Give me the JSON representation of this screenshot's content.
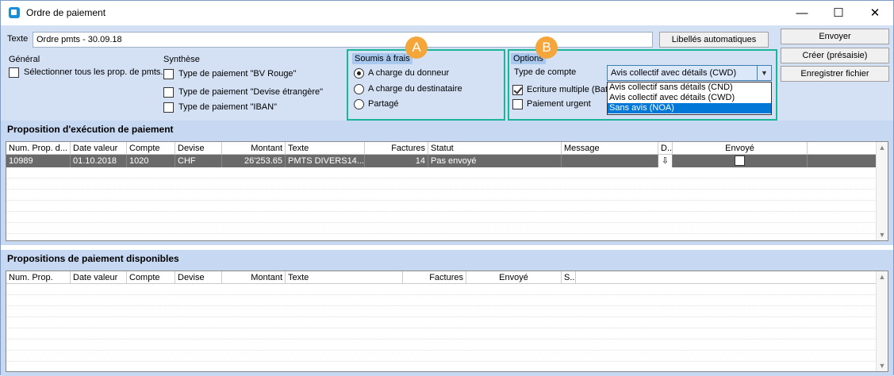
{
  "window": {
    "title": "Ordre de paiement",
    "minimize": "—",
    "maximize": "☐",
    "close": "✕"
  },
  "texte": {
    "label": "Texte",
    "value": "Ordre pmts - 30.09.18",
    "auto_button": "Libellés automatiques"
  },
  "actions": {
    "envoyer": "Envoyer",
    "creer": "Créer (présaisie)",
    "enregistrer": "Enregistrer fichier"
  },
  "general": {
    "header": "Général",
    "select_all": "Sélectionner tous les prop. de pmts."
  },
  "synthese": {
    "header": "Synthèse",
    "items": [
      "Type de paiement \"BV Rouge\"",
      "Type de paiement \"Devise étrangère\"",
      "Type de paiement \"IBAN\""
    ]
  },
  "frais": {
    "header": "Soumis à frais",
    "badge": "A",
    "options": [
      "A charge du donneur",
      "A charge du destinataire",
      "Partagé"
    ],
    "selected": 0
  },
  "options": {
    "header": "Options",
    "badge": "B",
    "type_compte_label": "Type de compte",
    "type_compte_value": "Avis collectif avec détails (CWD)",
    "dropdown_items": [
      "Avis collectif sans détails (CND)",
      "Avis collectif avec détails (CWD)",
      "Sans avis (NOA)"
    ],
    "dropdown_selected": 2,
    "ecriture_multiple": "Ecriture multiple (Batc",
    "ecriture_checked": true,
    "paiement_urgent": "Paiement urgent",
    "urgent_checked": false
  },
  "proposition": {
    "title": "Proposition d'exécution de paiement",
    "columns": [
      "Num. Prop. d...",
      "Date valeur",
      "Compte",
      "Devise",
      "Montant",
      "Texte",
      "Factures",
      "Statut",
      "Message",
      "D...",
      "Envoyé"
    ],
    "rows": [
      {
        "num": "10989",
        "date": "01.10.2018",
        "compte": "1020",
        "devise": "CHF",
        "montant": "26'253.65",
        "texte": "PMTS DIVERS14...",
        "factures": "14",
        "statut": "Pas envoyé",
        "message": "",
        "d": "⇩",
        "envoye": false
      }
    ]
  },
  "disponibles": {
    "title": "Propositions de paiement disponibles",
    "columns": [
      "Num. Prop.",
      "Date valeur",
      "Compte",
      "Devise",
      "Montant",
      "Texte",
      "Factures",
      "Envoyé",
      "S..."
    ]
  },
  "colors": {
    "panel": "#d4e1f5",
    "section": "#c7d8f2",
    "highlight": "#1bb59a",
    "badge": "#f4a63b",
    "row_selected": "#6a6a6a"
  }
}
